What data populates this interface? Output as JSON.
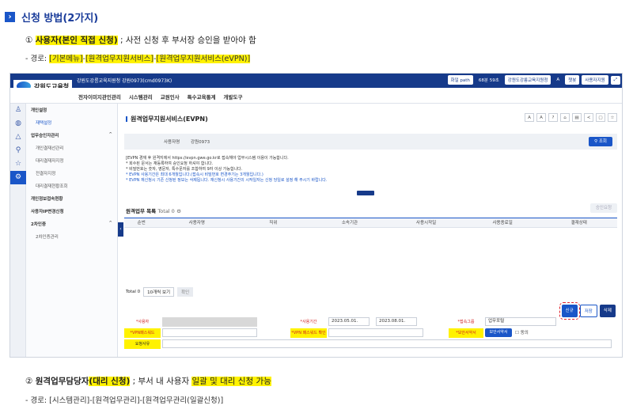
{
  "section": {
    "title": "신청 방법(2가지)"
  },
  "method1": {
    "num": "①",
    "name": "사용자(본인 직접 신청)",
    "desc": " ; 사전 신청 후 부서장 승인을 받아야 함",
    "path_prefix": "- 경로: ",
    "path_1": "[기본메뉴]",
    "path_sep1": "-",
    "path_2": "[원격업무지원서비스]",
    "path_sep2": "-",
    "path_3": "[원격업무지원서비스(eVPN)]"
  },
  "app": {
    "logo_text": "강원도교육청",
    "org_line": "강원도강릉교육지원청   강원0973(cmd0973K)",
    "topbar": {
      "path_label": "화일 path",
      "timer": "68분 59초",
      "office_select": "강원도강릉교육지원청",
      "chat_label": "챗봇",
      "support_label": "사용자지원"
    },
    "menus": [
      "전자이미지관인관리",
      "시스템관리",
      "교원인사",
      "특수교육통계",
      "개발도구"
    ],
    "sidebar": [
      {
        "label": "개인설정",
        "type": "group",
        "chev": ""
      },
      {
        "label": "재택설정",
        "type": "active",
        "chev": ""
      },
      {
        "label": "업무승인자관리",
        "type": "group",
        "chev": "^"
      },
      {
        "label": "개인결재선관리",
        "type": "sub",
        "chev": ""
      },
      {
        "label": "대리결재자지정",
        "type": "sub",
        "chev": ""
      },
      {
        "label": "전결자지정",
        "type": "sub",
        "chev": ""
      },
      {
        "label": "대리결재현황조회",
        "type": "sub",
        "chev": ""
      },
      {
        "label": "개인정보접속현황",
        "type": "group",
        "chev": ""
      },
      {
        "label": "사용자IP변경신청",
        "type": "group",
        "chev": ""
      },
      {
        "label": "2차인증",
        "type": "group",
        "chev": "^"
      },
      {
        "label": "2차인증관리",
        "type": "sub",
        "chev": ""
      }
    ],
    "page_title": "원격업무지원서비스(EVPN)",
    "filter": {
      "label": "사용자명",
      "value": "강원0973",
      "search_label": "조회"
    },
    "notice": {
      "line1": "[EVPN 경재 후 원격지에서 https://evpn.gwe.go.kr로 접속해야 업무시스템 이용이 가능합니다.",
      "line2": "* 회수된 문서는 재등록하여 승인요청 하셔야 합니다.",
      "line3": "* 비밀번호는 숫자, 영문자, 특수문자를 조합하여 9자 이상 가능합니다.",
      "line4": "* EVPN 사용기간은 최대 6개월입니다.(접속시 비밀번호 변경주기는 3개월입니다.)",
      "line5": "* EVPN 재신청시 기존 신청된 정보는 삭제됩니다. 재신청시 사용기간의 시작일자는 신청 당일로 설정 해 주시기 바랍니다."
    },
    "list": {
      "title": "원격업무 목록",
      "total_label": "Total 0",
      "approve_label": "승인요청",
      "columns": [
        "순번",
        "사용자명",
        "직위",
        "소속기관",
        "사용시작일",
        "사용종료일",
        "결재상태"
      ]
    },
    "pager": {
      "total": "Total 0",
      "page_size": "10개씩 보기",
      "confirm": "확인"
    },
    "actions": {
      "new": "신규",
      "save": "저장",
      "delete": "삭제"
    },
    "form": {
      "user_label": "*사용자",
      "period_label": "*사용기간",
      "start_date": "2023.05.01.",
      "end_date": "2023.08.01.",
      "group_label": "*접속그룹",
      "group_value": "업무포털",
      "pw_label": "*VPN패스워드",
      "pw_confirm_label": "*VPN 패스워드 확인",
      "pledge_label": "*보안서약서",
      "pledge_button": "보안서약서",
      "agree_label": "동의",
      "reason_label": "요청사유"
    }
  },
  "method2": {
    "num": "②",
    "name_pre": "원격업무담당자",
    "name_hl": "(대리 신청)",
    "desc_pre": " ; 부서 내 사용자 ",
    "desc_hl": "일괄 및 대리 신청 가능",
    "path": "- 경로: [시스템관리]-[원격업무관리]-[원격업무관리(일괄신청)]"
  }
}
